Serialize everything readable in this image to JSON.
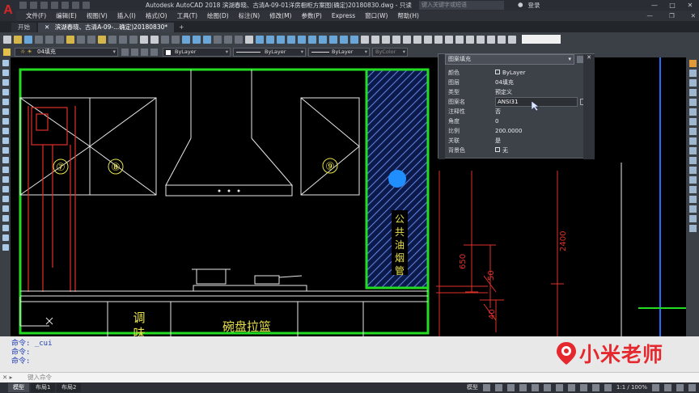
{
  "app": {
    "title": "Autodesk AutoCAD 2018    滨湖春晓、古清A-09-01洋房橱柜方案图(确定)20180830.dwg - 只读",
    "search_placeholder": "键入关键字或短语",
    "login": "登录",
    "window_controls": [
      "—",
      "□",
      "✕"
    ]
  },
  "menu": [
    "文件(F)",
    "编辑(E)",
    "视图(V)",
    "插入(I)",
    "格式(O)",
    "工具(T)",
    "绘图(D)",
    "标注(N)",
    "修改(M)",
    "参数(P)",
    "Express",
    "窗口(W)",
    "帮助(H)"
  ],
  "tabs": [
    {
      "label": "开始",
      "active": false
    },
    {
      "label": "滨湖春晓、古清A-09-...确定)20180830*",
      "active": true,
      "close": "✕"
    }
  ],
  "layer_dropdown": "04填充",
  "prop_dropdowns": [
    "ByLayer",
    "ByLayer",
    "ByLayer",
    "ByColor"
  ],
  "properties_palette": {
    "object_type": "图案填充",
    "rows": [
      {
        "key": "颜色",
        "value": "ByLayer"
      },
      {
        "key": "图层",
        "value": "04填充"
      },
      {
        "key": "类型",
        "value": "预定义"
      },
      {
        "key": "图案名",
        "value": "ANSI31"
      },
      {
        "key": "注释性",
        "value": "否"
      },
      {
        "key": "角度",
        "value": "0"
      },
      {
        "key": "比例",
        "value": "200.0000"
      },
      {
        "key": "关联",
        "value": "是"
      },
      {
        "key": "背景色",
        "value": "无"
      }
    ]
  },
  "drawing": {
    "cabinet_numbers": [
      "⑦",
      "⑧",
      "⑨"
    ],
    "duct_label": [
      "公",
      "共",
      "油",
      "烟",
      "管"
    ],
    "drawer_label": "碗盘拉篮",
    "side_label": [
      "调",
      "味"
    ],
    "dimensions": [
      "650",
      "50",
      "40",
      "2400"
    ],
    "colors": {
      "green": "#22dd22",
      "red": "#e0302a",
      "blue": "#2a6bff",
      "white": "#e8e8e8",
      "yellow": "#e9e24a"
    }
  },
  "command_history": [
    "命令: _cui",
    "命令:",
    "命令:"
  ],
  "command_input_placeholder": "键入命令",
  "status": {
    "layout_tabs": [
      "模型",
      "布局1",
      "布局2"
    ],
    "model_label": "模型",
    "scale": "1:1 / 100%"
  },
  "watermark": "小米老师"
}
